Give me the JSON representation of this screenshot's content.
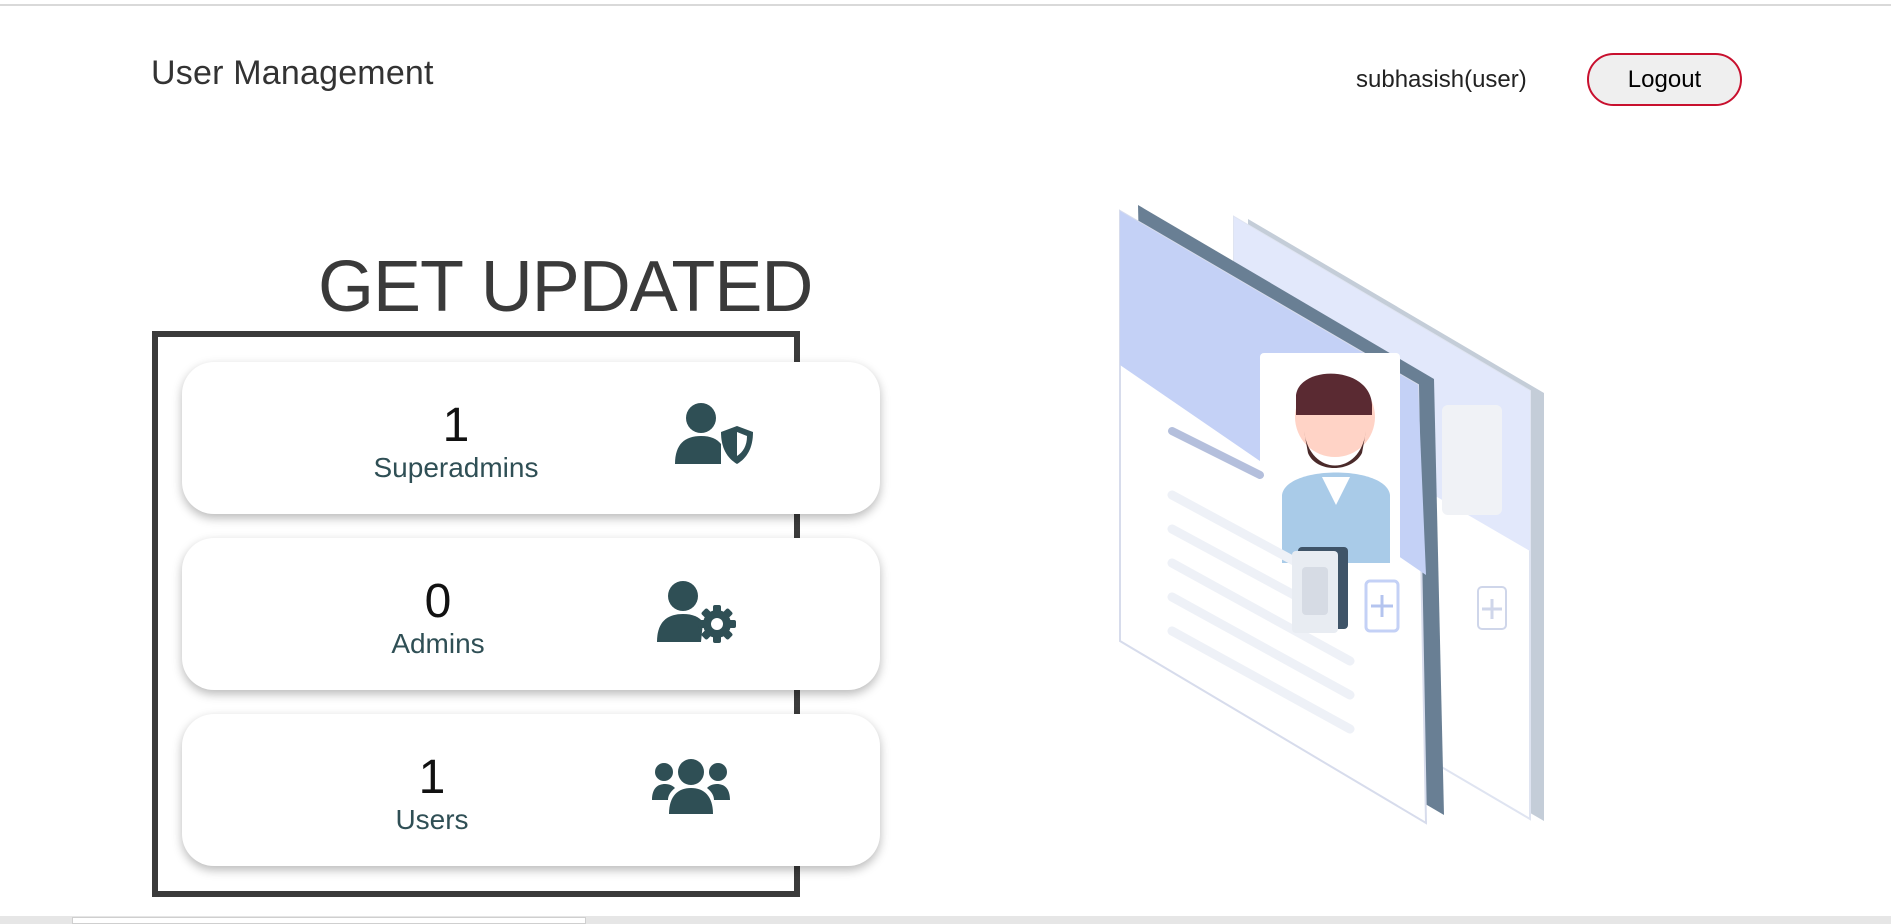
{
  "header": {
    "app_title": "User Management",
    "user_label": "subhasish(user)",
    "logout_label": "Logout"
  },
  "main": {
    "heading": "GET UPDATED",
    "stats": [
      {
        "value": "1",
        "label": "Superadmins",
        "icon": "user-shield-icon"
      },
      {
        "value": "0",
        "label": "Admins",
        "icon": "user-gear-icon"
      },
      {
        "value": "1",
        "label": "Users",
        "icon": "users-group-icon"
      }
    ]
  },
  "illustration": {
    "icon": "profile-cards-illustration"
  },
  "colors": {
    "icon": "#2f4f55",
    "logout_border": "#c8102e",
    "frame": "#3b3b3b",
    "heading": "#3a3a3a"
  }
}
